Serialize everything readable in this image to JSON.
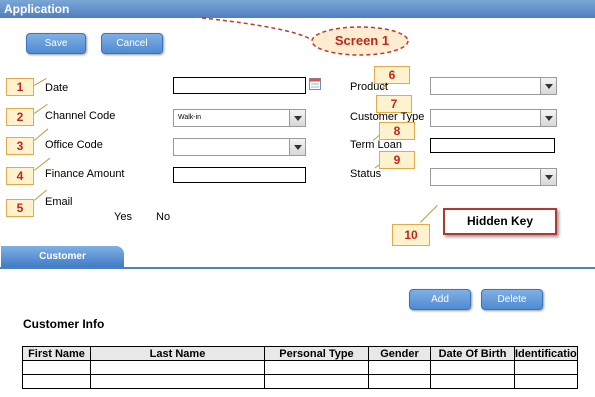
{
  "window": {
    "title": "Application"
  },
  "toolbar": {
    "save_label": "Save",
    "cancel_label": "Cancel"
  },
  "annotation": {
    "screen_label": "Screen 1",
    "hidden_key_label": "Hidden Key"
  },
  "callouts": [
    "1",
    "2",
    "3",
    "4",
    "5",
    "6",
    "7",
    "8",
    "9",
    "10"
  ],
  "form": {
    "date_label": "Date",
    "channel_code_label": "Channel Code",
    "channel_code_value": "Walk-in",
    "office_code_label": "Office Code",
    "finance_amount_label": "Finance Amount",
    "email_label": "Email",
    "email_yes": "Yes",
    "email_no": "No",
    "product_label": "Product",
    "customer_type_label": "Customer Type",
    "term_loan_label": "Term Loan",
    "status_label": "Status"
  },
  "tabs": {
    "customer_label": "Customer"
  },
  "customer_section": {
    "add_label": "Add",
    "delete_label": "Delete",
    "title": "Customer Info",
    "columns": [
      "First  Name",
      "Last Name",
      "Personal Type",
      "Gender",
      "Date Of Birth",
      "Identification"
    ]
  },
  "colors": {
    "title_bar": "#5b8ac9",
    "callout_text": "#c0261b",
    "callout_fill": "#fff3cf",
    "hidden_key_border": "#b03a2e"
  },
  "icons": {
    "date_picker": "calendar-icon",
    "dropdown": "chevron-down-icon"
  }
}
